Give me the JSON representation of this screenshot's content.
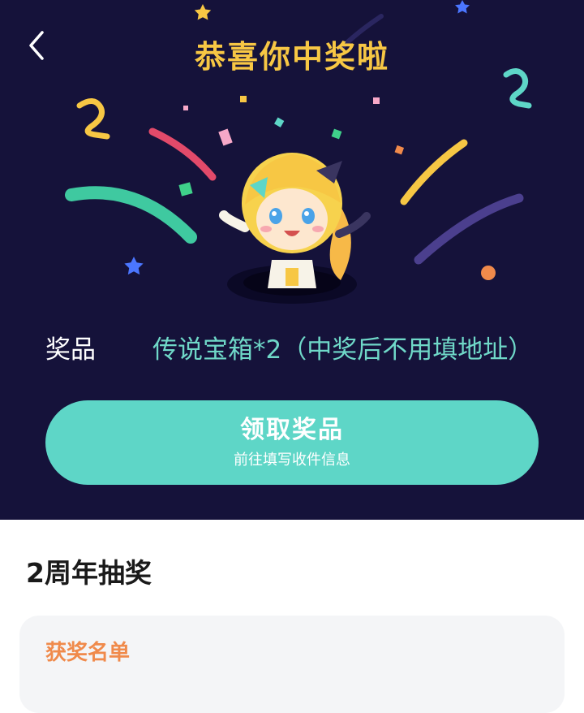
{
  "header": {
    "title": "恭喜你中奖啦",
    "back_icon": "chevron-left-icon"
  },
  "prize": {
    "label": "奖品",
    "value": "传说宝箱*2（中奖后不用填地址）"
  },
  "claim_button": {
    "label": "领取奖品",
    "sublabel": "前往填写收件信息"
  },
  "section": {
    "title": "2周年抽奖"
  },
  "winners_card": {
    "title": "获奖名单"
  },
  "colors": {
    "hero_bg": "#15123a",
    "title": "#f7c744",
    "prize_value": "#6fd8c8",
    "button": "#5ed6c7",
    "card_title": "#f08a4b"
  }
}
